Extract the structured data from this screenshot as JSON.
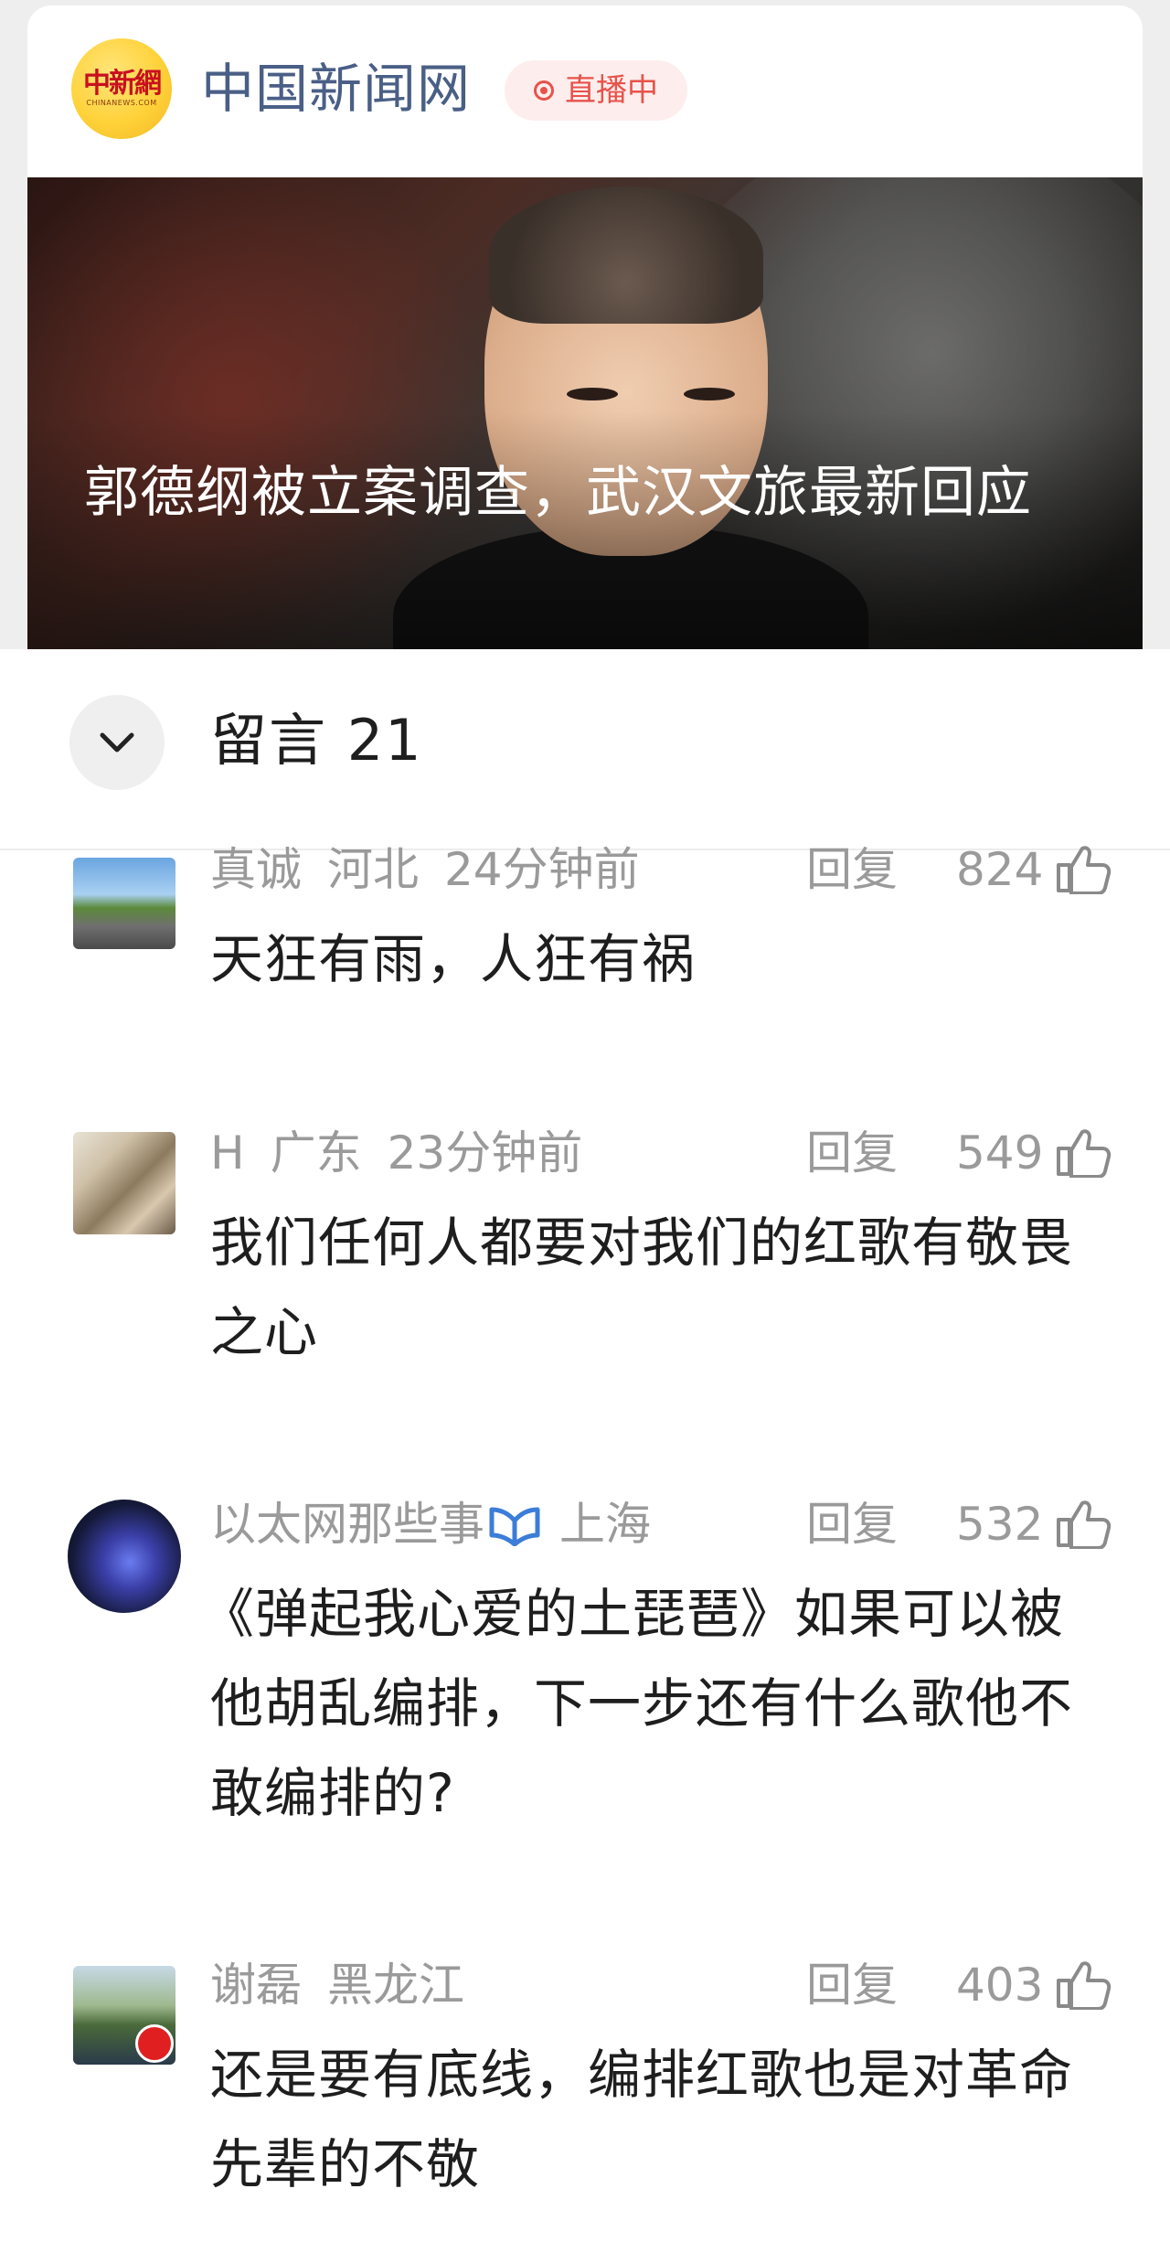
{
  "article_card": {
    "publisher": "中国新闻网",
    "logo_text": "中新網",
    "logo_subtext": "CHINANEWS.COM",
    "live_badge": "直播中",
    "headline": "郭德纲被立案调查，武汉文旅最新回应"
  },
  "comments_panel": {
    "title": "留言 21",
    "collapse_icon": "chevron-down-icon",
    "reply_label": "回复",
    "like_icon": "thumbs-up-icon",
    "comments": [
      {
        "user": "真诚",
        "location": "河北",
        "time": "24分钟前",
        "likes": "824",
        "text": "天狂有雨，人狂有祸"
      },
      {
        "user": "H",
        "location": "广东",
        "time": "23分钟前",
        "likes": "549",
        "text": "我们任何人都要对我们的红歌有敬畏之心"
      },
      {
        "user": "以太网那些事",
        "location": "上海",
        "time": "",
        "verified": true,
        "likes": "532",
        "text": "《弹起我心爱的土琵琶》如果可以被他胡乱编排，下一步还有什么歌他不敢编排的?"
      },
      {
        "user": "谢磊",
        "location": "黑龙江",
        "time": "",
        "likes": "403",
        "text": "还是要有底线，编排红歌也是对革命先辈的不敬"
      }
    ]
  },
  "colors": {
    "publisher_text": "#4a5f86",
    "live_red": "#e8524a",
    "meta_gray": "#9a9a9a",
    "body_text": "#1e1e1e",
    "verified_blue": "#3b7dd8"
  }
}
